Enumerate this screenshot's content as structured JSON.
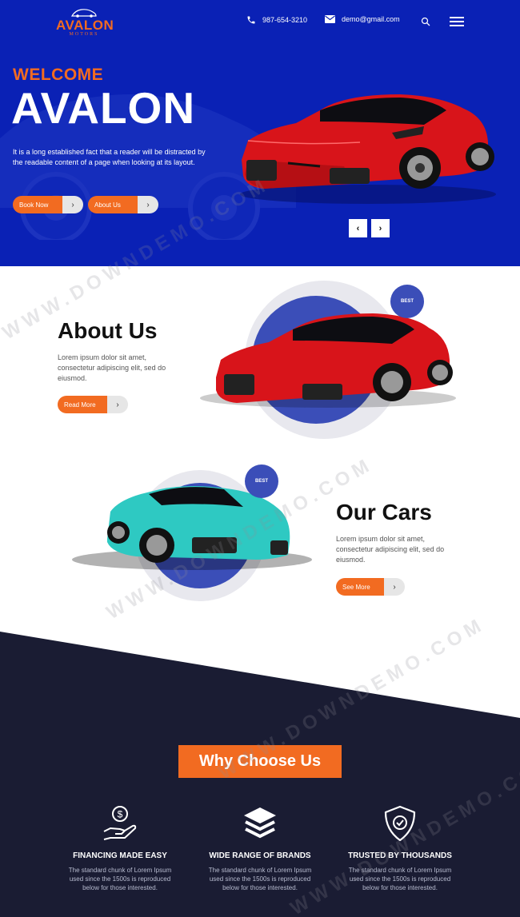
{
  "brand": {
    "name": "AVALON",
    "tagline": "MOTORS"
  },
  "nav": {
    "phone": "987-654-3210",
    "email": "demo@gmail.com"
  },
  "hero": {
    "welcome": "WELCOME",
    "title": "AVALON",
    "description": "It is a long established fact that a reader will be distracted by the readable content of a page when looking at its layout.",
    "book_label": "Book Now",
    "about_label": "About Us"
  },
  "about": {
    "title": "About Us",
    "text": "Lorem ipsum dolor sit amet, consectetur adipiscing elit, sed do eiusmod.",
    "button_label": "Read More",
    "badge": "BEST"
  },
  "cars": {
    "title": "Our Cars",
    "text": "Lorem ipsum dolor sit amet, consectetur adipiscing elit, sed do eiusmod.",
    "button_label": "See More",
    "badge": "BEST"
  },
  "why": {
    "title": "Why Choose Us",
    "features": [
      {
        "icon": "financing-icon",
        "title": "FINANCING MADE EASY",
        "text": "The standard chunk of Lorem Ipsum used since the 1500s is reproduced below for those interested."
      },
      {
        "icon": "layers-icon",
        "title": "WIDE RANGE OF BRANDS",
        "text": "The standard chunk of Lorem Ipsum used since the 1500s is reproduced below for those interested."
      },
      {
        "icon": "shield-check-icon",
        "title": "TRUSTED BY THOUSANDS",
        "text": "The standard chunk of Lorem Ipsum used since the 1500s is reproduced below for those interested."
      }
    ]
  },
  "watermark": "WWW.DOWNDEMO.COM",
  "colors": {
    "hero_bg": "#0a21b5",
    "accent": "#f26b21",
    "dark_bg": "#1a1c33",
    "circle": "#3b4eb8",
    "ring": "#e8e8ee"
  }
}
